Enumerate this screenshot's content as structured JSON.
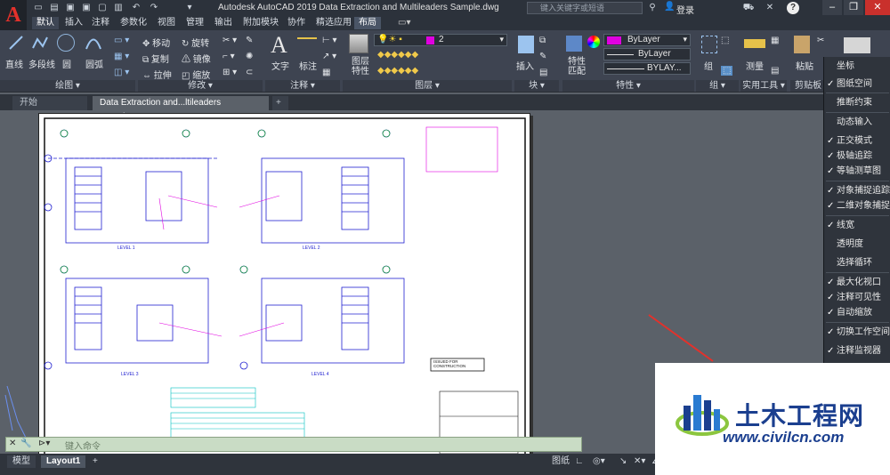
{
  "app": {
    "logo_letter": "A",
    "title": "Autodesk AutoCAD 2019    Data Extraction and Multileaders Sample.dwg",
    "search_placeholder": "键入关键字或短语",
    "login": "登录",
    "help": "?"
  },
  "ribbon_tabs": [
    {
      "label": "默认",
      "active": true
    },
    {
      "label": "插入"
    },
    {
      "label": "注释"
    },
    {
      "label": "参数化"
    },
    {
      "label": "视图"
    },
    {
      "label": "管理"
    },
    {
      "label": "输出"
    },
    {
      "label": "附加模块"
    },
    {
      "label": "协作"
    },
    {
      "label": "精选应用"
    },
    {
      "label": "布局"
    }
  ],
  "ribbon": {
    "draw": {
      "line": "直线",
      "polyline": "多段线",
      "circle": "圆",
      "arc": "圆弧",
      "panel": "绘图 ▾"
    },
    "modify": {
      "move": "移动",
      "rotate": "旋转",
      "copy": "复制",
      "mirror": "镜像",
      "stretch": "拉伸",
      "scale": "缩放",
      "panel": "修改 ▾"
    },
    "annotation": {
      "text": "文字",
      "dimension": "标注",
      "panel": "注释 ▾"
    },
    "layers": {
      "properties": "图层\n特性",
      "current_layer": "2",
      "panel": "图层 ▾"
    },
    "block": {
      "insert": "插入",
      "panel": "块 ▾"
    },
    "properties": {
      "match": "特性\n匹配",
      "color": "ByLayer",
      "linetype": "ByLayer",
      "lineweight": "BYLAY...",
      "panel": "特性 ▾"
    },
    "groups": {
      "group": "组",
      "panel": "组 ▾"
    },
    "utilities": {
      "measure": "测量",
      "panel": "实用工具 ▾"
    },
    "clipboard": {
      "paste": "粘贴",
      "panel": "剪贴板"
    }
  },
  "doc_tabs": [
    {
      "label": "开始"
    },
    {
      "label": "Data Extraction and...ltileaders Sample*",
      "active": true
    }
  ],
  "context_menu": {
    "items": [
      {
        "label": "坐标",
        "checked": false
      },
      {
        "label": "图纸空间",
        "checked": true
      },
      {
        "label": "推断约束",
        "checked": false
      },
      {
        "label": "动态输入",
        "checked": false
      },
      {
        "label": "正交模式",
        "checked": true
      },
      {
        "label": "极轴追踪",
        "checked": true
      },
      {
        "label": "等轴测草图",
        "checked": true
      },
      {
        "label": "对象捕捉追踪",
        "checked": true
      },
      {
        "label": "二维对象捕捉",
        "checked": true
      },
      {
        "label": "线宽",
        "checked": true
      },
      {
        "label": "透明度",
        "checked": false
      },
      {
        "label": "选择循环",
        "checked": false
      },
      {
        "label": "最大化视口",
        "checked": true
      },
      {
        "label": "注释可见性",
        "checked": true
      },
      {
        "label": "自动缩放",
        "checked": true
      },
      {
        "label": "切换工作空间",
        "checked": true
      },
      {
        "label": "注释监视器",
        "checked": true
      }
    ]
  },
  "drawing": {
    "level_labels": [
      "LEVEL 1",
      "LEVEL 2",
      "LEVEL 3",
      "LEVEL 4"
    ],
    "stamp": "ISSUED FOR\nCONSTRUCTION"
  },
  "command_line": {
    "placeholder": "键入命令"
  },
  "status": {
    "model_tab": "模型",
    "layout_tab": "Layout1",
    "add": "+",
    "paper": "图纸"
  },
  "watermark": {
    "title": "土木工程网",
    "url": "www.civilcn.com"
  },
  "colors": {
    "accent_red": "#e3312b",
    "layer_magenta": "#e000e0",
    "drawing_blue": "#2020d0"
  }
}
